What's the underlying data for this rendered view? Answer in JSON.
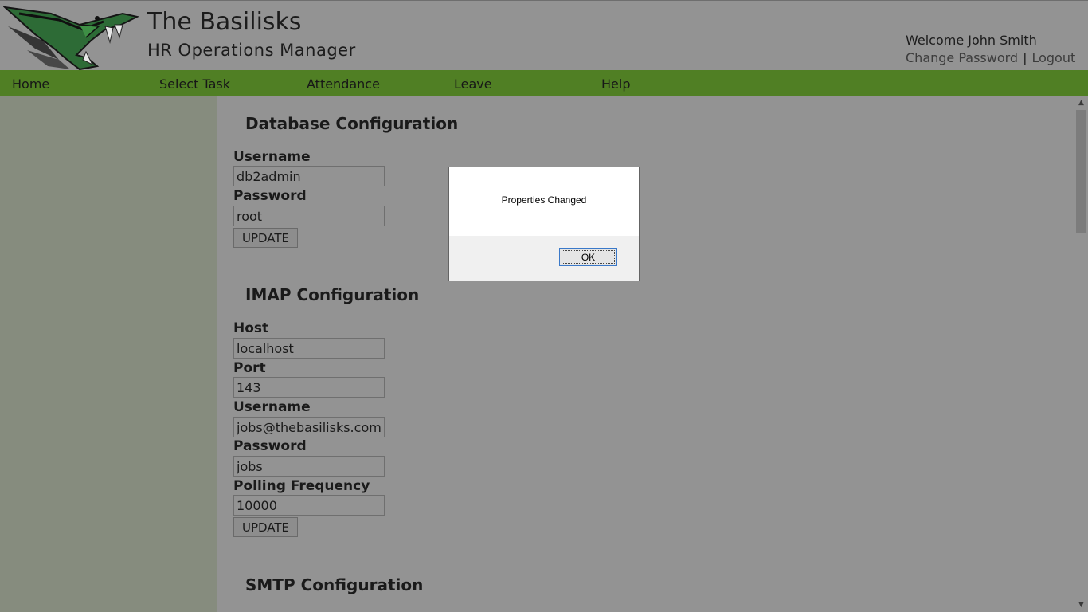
{
  "header": {
    "title": "The Basilisks",
    "subtitle": "HR Operations Manager",
    "welcome": "Welcome John Smith",
    "change_password": "Change Password",
    "separator": "|",
    "logout": "Logout",
    "logo_icon": "basilisk-logo-icon"
  },
  "nav": {
    "items": [
      {
        "label": "Home"
      },
      {
        "label": "Select Task"
      },
      {
        "label": "Attendance"
      },
      {
        "label": "Leave"
      },
      {
        "label": "Help"
      }
    ]
  },
  "database": {
    "title": "Database Configuration",
    "username_label": "Username",
    "username_value": "db2admin",
    "password_label": "Password",
    "password_value": "root",
    "update_label": "UPDATE"
  },
  "imap": {
    "title": "IMAP Configuration",
    "host_label": "Host",
    "host_value": "localhost",
    "port_label": "Port",
    "port_value": "143",
    "username_label": "Username",
    "username_value": "jobs@thebasilisks.com",
    "password_label": "Password",
    "password_value": "jobs",
    "polling_label": "Polling Frequency",
    "polling_value": "10000",
    "update_label": "UPDATE"
  },
  "smtp": {
    "title": "SMTP Configuration"
  },
  "dialog": {
    "message": "Properties Changed",
    "ok_label": "OK"
  },
  "colors": {
    "nav_green": "#507f24",
    "overlay_gray": "#939393",
    "sidebar": "#868c7e",
    "logo_green": "#2f7a3a"
  }
}
